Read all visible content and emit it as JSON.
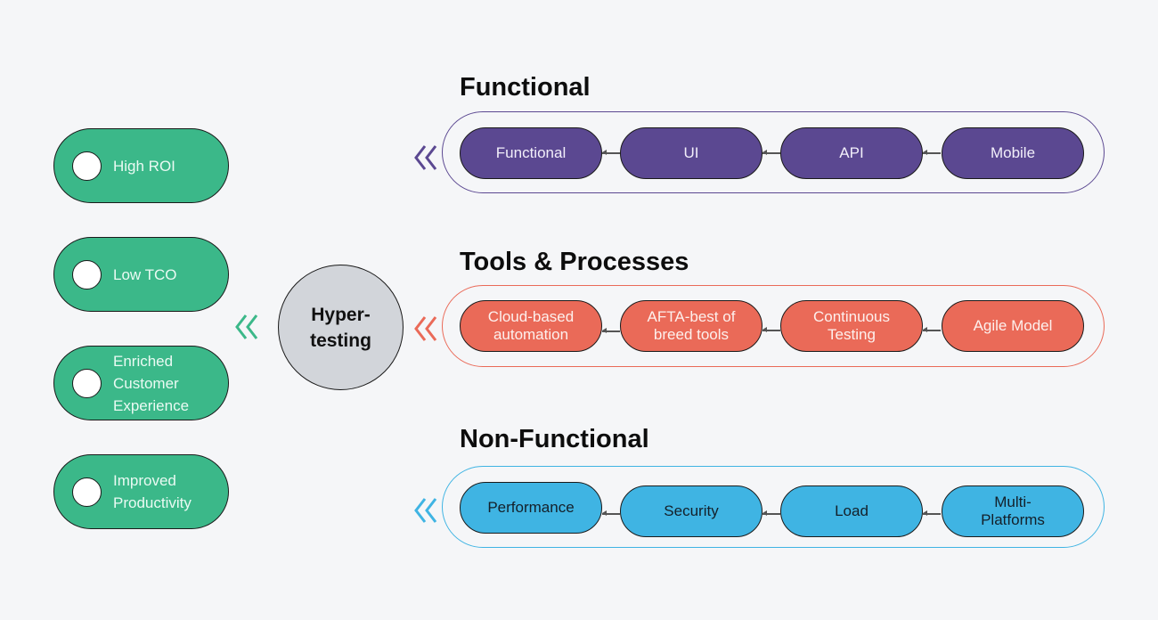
{
  "colors": {
    "background": "#f5f6f8",
    "benefit": "#3bb889",
    "hub": "#d2d5da",
    "functional": "#5b4891",
    "tools": "#ea6a58",
    "non_functional": "#3fb4e3"
  },
  "benefits": [
    {
      "label": "High ROI"
    },
    {
      "label": "Low TCO"
    },
    {
      "label": "Enriched\nCustomer\nExperience"
    },
    {
      "label": "Improved\nProductivity"
    }
  ],
  "hub": {
    "label": "Hyper-\ntesting"
  },
  "groups": [
    {
      "title": "Functional",
      "nodes": [
        {
          "label": "Functional"
        },
        {
          "label": "UI"
        },
        {
          "label": "API"
        },
        {
          "label": "Mobile"
        }
      ]
    },
    {
      "title": "Tools & Processes",
      "nodes": [
        {
          "label": "Cloud-based\nautomation"
        },
        {
          "label": "AFTA-best of\nbreed tools"
        },
        {
          "label": "Continuous\nTesting"
        },
        {
          "label": "Agile Model"
        }
      ]
    },
    {
      "title": "Non-Functional",
      "nodes": [
        {
          "label": "Performance"
        },
        {
          "label": "Security"
        },
        {
          "label": "Load"
        },
        {
          "label": "Multi-\nPlatforms"
        }
      ]
    }
  ]
}
